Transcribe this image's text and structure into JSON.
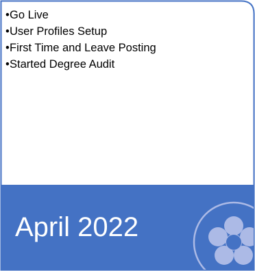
{
  "bullet_glyph": "•",
  "items": [
    {
      "label": "Go Live"
    },
    {
      "label": "User Profiles Setup"
    },
    {
      "label": "First Time and Leave Posting"
    },
    {
      "label": "Started Degree Audit"
    }
  ],
  "banner": {
    "title": "April 2022",
    "background_color": "#4472C4",
    "icon": "flower-icon",
    "icon_color": "#ACBAE6"
  },
  "card": {
    "border_color": "#4472C4"
  }
}
